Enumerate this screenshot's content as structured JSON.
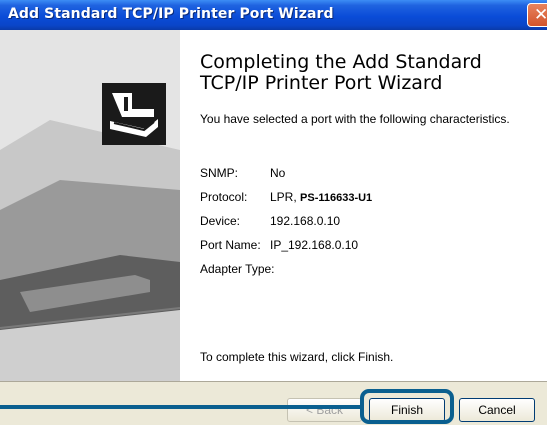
{
  "window": {
    "title": "Add Standard TCP/IP Printer Port Wizard",
    "close_glyph": "✕"
  },
  "header": {
    "heading": "Completing the Add Standard TCP/IP Printer Port Wizard"
  },
  "intro": "You have selected a port with the following characteristics.",
  "details": [
    {
      "label": "SNMP:",
      "value": "No",
      "extra": ""
    },
    {
      "label": "Protocol:",
      "value": "LPR, ",
      "extra": "PS-116633-U1"
    },
    {
      "label": "Device:",
      "value": "192.168.0.10",
      "extra": ""
    },
    {
      "label": "Port Name:",
      "value": "IP_192.168.0.10",
      "extra": ""
    },
    {
      "label": "Adapter Type:",
      "value": "",
      "extra": ""
    }
  ],
  "footer_text": "To complete this wizard, click Finish.",
  "buttons": {
    "back": "< Back",
    "finish": "Finish",
    "cancel": "Cancel"
  },
  "icons": {
    "wizard_graphic": "printer-port-wizard-icon",
    "close": "close-icon"
  },
  "colors": {
    "title_bar": "#0a4cd8",
    "highlight": "#0a5f8f",
    "left_panel": "#e3e3e3",
    "close_button": "#d2542c"
  }
}
